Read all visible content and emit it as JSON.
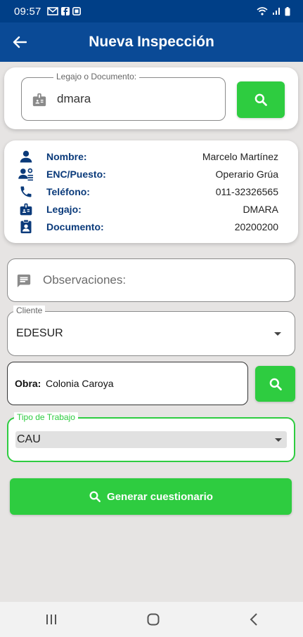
{
  "status_bar": {
    "time": "09:57"
  },
  "app_bar": {
    "title": "Nueva Inspección"
  },
  "search": {
    "legend": "Legajo o Documento:",
    "value": "dmara"
  },
  "info": {
    "rows": [
      {
        "label": "Nombre:",
        "value": "Marcelo Martínez"
      },
      {
        "label": "ENC/Puesto:",
        "value": "Operario Grúa"
      },
      {
        "label": "Teléfono:",
        "value": "011-32326565"
      },
      {
        "label": "Legajo:",
        "value": "DMARA"
      },
      {
        "label": "Documento:",
        "value": "20200200"
      }
    ]
  },
  "observaciones": {
    "placeholder": "Observaciones:"
  },
  "cliente": {
    "legend": "Cliente",
    "value": "EDESUR"
  },
  "obra": {
    "label": "Obra:",
    "value": "Colonia Caroya"
  },
  "tipo_trabajo": {
    "legend": "Tipo de Trabajo",
    "value": "CAU"
  },
  "generate_button": {
    "label": "Generar cuestionario"
  },
  "colors": {
    "primary": "#0a4a96",
    "status_bar": "#003f87",
    "accent_green": "#2ecc40",
    "background": "#e6e4e3"
  },
  "icons": [
    "back-arrow-icon",
    "badge-icon",
    "search-icon",
    "person-icon",
    "position-icon",
    "phone-icon",
    "id-card-icon",
    "comment-icon",
    "dropdown-arrow-icon"
  ]
}
